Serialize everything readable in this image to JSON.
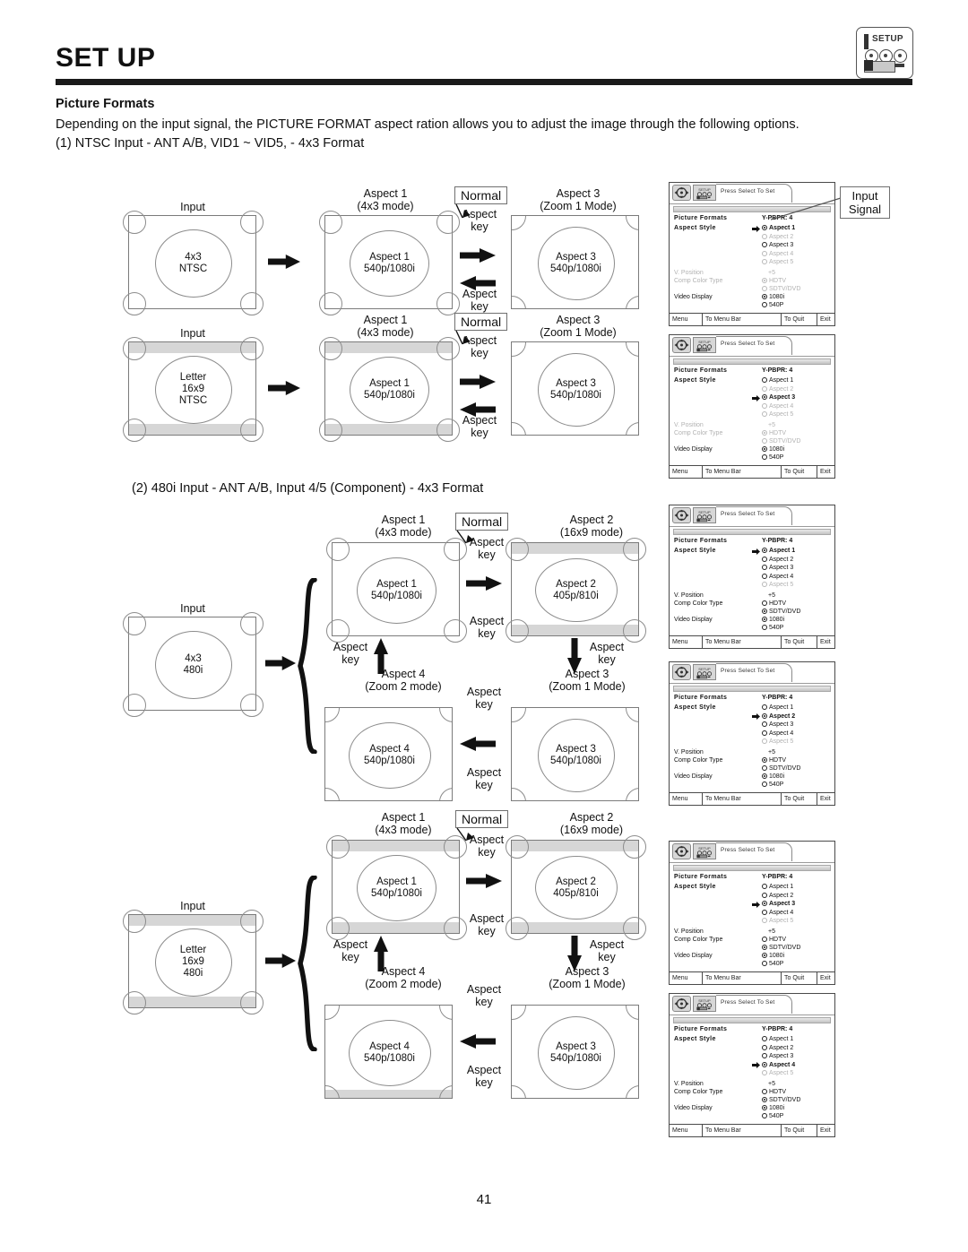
{
  "header": {
    "title": "SET UP",
    "icon_label": "SETUP",
    "icon_name": "setup-camera-icon"
  },
  "content": {
    "subhead": "Picture Formats",
    "intro": "Depending on the input signal, the PICTURE FORMAT aspect ration allows you to adjust the image through the following options.",
    "section1": "(1)  NTSC Input - ANT A/B, VID1 ~ VID5, - 4x3 Format",
    "section2": "(2)  480i Input - ANT A/B, Input 4/5 (Component) - 4x3 Format",
    "page_number": "41"
  },
  "labels": {
    "input": "Input",
    "normal": "Normal",
    "aspect_key": "Aspect\nkey",
    "aspect_key_l1": "Aspect",
    "aspect_key_l2": "key",
    "callout_input_signal_l1": "Input",
    "callout_input_signal_l2": "Signal"
  },
  "screens": {
    "in_4x3_ntsc": {
      "l1": "4x3",
      "l2": "NTSC",
      "caption": "Input"
    },
    "in_letter_ntsc": {
      "l1": "Letter",
      "l2": "16x9",
      "l3": "NTSC",
      "caption": "Input"
    },
    "in_4x3_480i": {
      "l1": "4x3",
      "l2": "480i",
      "caption": "Input"
    },
    "in_letter_480i": {
      "l1": "Letter",
      "l2": "16x9",
      "l3": "480i",
      "caption": "Input"
    },
    "a1": {
      "cap1": "Aspect 1",
      "cap2": "(4x3 mode)",
      "t1": "Aspect 1",
      "t2": "540p/1080i"
    },
    "a2": {
      "cap1": "Aspect 2",
      "cap2": "(16x9 mode)",
      "t1": "Aspect 2",
      "t2": "405p/810i"
    },
    "a3": {
      "cap1": "Aspect 3",
      "cap2": "(Zoom 1 Mode)",
      "t1": "Aspect 3",
      "t2": "540p/1080i"
    },
    "a4": {
      "cap1": "Aspect 4",
      "cap2": "(Zoom 2 mode)",
      "t1": "Aspect 4",
      "t2": "540p/1080i"
    }
  },
  "osd": {
    "tab_text": "Press Select To Set",
    "row_title": "Picture Formats",
    "row_signal": "Y-PBPR: 4",
    "row_aspect_style": "Aspect Style",
    "aspect_options": [
      "Aspect 1",
      "Aspect 2",
      "Aspect 3",
      "Aspect 4",
      "Aspect 5"
    ],
    "row_v_position": "V. Position",
    "v_position_value": "+5",
    "row_comp_color": "Comp Color Type",
    "comp_options": [
      "HDTV",
      "SDTV/DVD"
    ],
    "row_video_display": "Video Display",
    "video_options": [
      "1080i",
      "540P"
    ],
    "footer": [
      "Menu",
      "To Menu Bar",
      "To Quit",
      "Exit"
    ],
    "panels": [
      {
        "selected_aspect": 1,
        "dim_aspects": [
          2,
          4,
          5
        ],
        "comp_selected": 1,
        "comp_dim": [
          1,
          2
        ],
        "video_selected": 1,
        "dim_vpos": true,
        "dim_comp_label": true
      },
      {
        "selected_aspect": 3,
        "dim_aspects": [
          2,
          4,
          5
        ],
        "comp_selected": 1,
        "comp_dim": [
          1,
          2
        ],
        "video_selected": 1,
        "dim_vpos": true,
        "dim_comp_label": true
      },
      {
        "selected_aspect": 1,
        "dim_aspects": [
          5
        ],
        "comp_selected": 2,
        "comp_dim": [],
        "video_selected": 1,
        "dim_vpos": false,
        "dim_comp_label": false
      },
      {
        "selected_aspect": 2,
        "dim_aspects": [
          5
        ],
        "comp_selected": 1,
        "comp_dim": [],
        "video_selected": 1,
        "dim_vpos": false,
        "dim_comp_label": false
      },
      {
        "selected_aspect": 3,
        "dim_aspects": [
          5
        ],
        "comp_selected": 2,
        "comp_dim": [],
        "video_selected": 1,
        "dim_vpos": false,
        "dim_comp_label": false
      },
      {
        "selected_aspect": 4,
        "dim_aspects": [
          5
        ],
        "comp_selected": 2,
        "comp_dim": [],
        "video_selected": 1,
        "dim_vpos": false,
        "dim_comp_label": false
      }
    ]
  }
}
